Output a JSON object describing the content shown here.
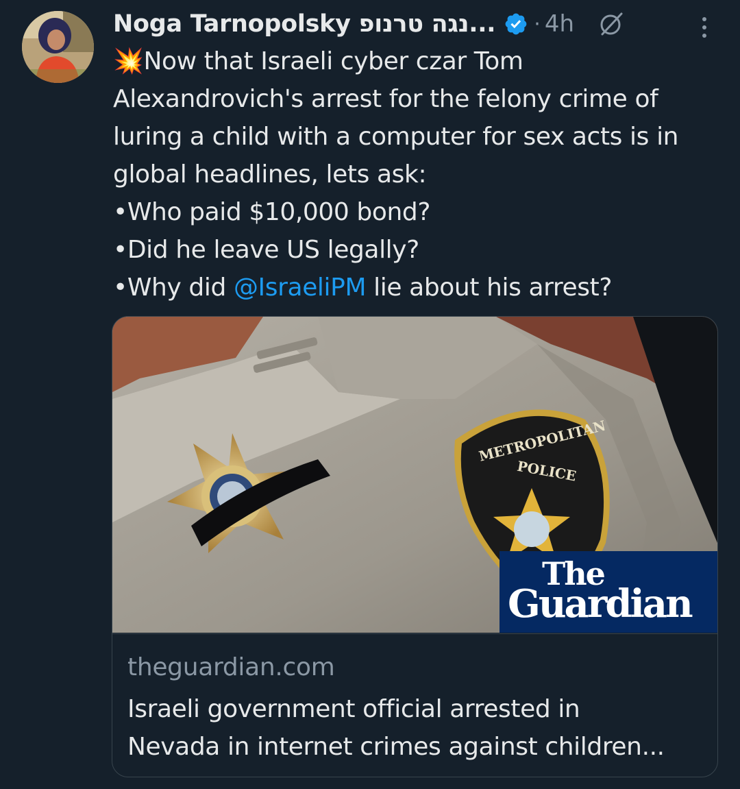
{
  "tweet": {
    "author": {
      "display_name": "Noga Tarnopolsky נגה טרנופ...",
      "verified": true
    },
    "timestamp": "4h",
    "separator": "·",
    "text_lines": [
      {
        "prefix": "💥",
        "text": "Now that Israeli cyber czar Tom"
      },
      {
        "text": "Alexandrovich's arrest for the felony crime of"
      },
      {
        "text": "luring a child with a computer for sex acts is in"
      },
      {
        "text": "global headlines, lets ask:"
      },
      {
        "text": "•Who paid $10,000 bond?"
      },
      {
        "text": "•Did he leave US legally?"
      },
      {
        "before": "•Why did ",
        "mention": "@IsraeliPM",
        "after": " lie about his arrest?"
      }
    ]
  },
  "link_card": {
    "badge": {
      "line1": "The",
      "line2": "Guardian"
    },
    "domain": "theguardian.com",
    "title_lines": [
      "Israeli government official arrested in",
      "Nevada in internet crimes against children..."
    ]
  },
  "icons": {
    "verified": "verified-badge-icon",
    "grok": "grok-icon",
    "more": "more-vertical-icon"
  },
  "colors": {
    "background": "#15202b",
    "text": "#e7e9ea",
    "secondary_text": "#8b98a5",
    "accent": "#1d9bf0",
    "border": "#38444d",
    "guardian_blue": "#052962"
  }
}
